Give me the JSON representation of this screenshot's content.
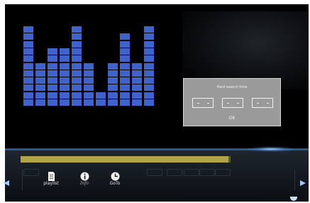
{
  "equalizer": {
    "color": "#3f63cc",
    "bars": [
      11,
      6,
      8,
      8,
      11,
      6,
      2,
      6,
      10,
      6,
      11
    ]
  },
  "dialog": {
    "title": "Hard search time",
    "time_fields": [
      "- -  :  - -",
      "- -  :  - -",
      "- -  :  - -"
    ],
    "ok_label": "OK"
  },
  "progress": {
    "fraction": 0.99,
    "color": "#b2a24a"
  },
  "menu": {
    "items": [
      {
        "name": "playlist",
        "label": "playlist",
        "icon": "document-icon"
      },
      {
        "name": "info",
        "label": "Info",
        "icon": "info-icon"
      },
      {
        "name": "goto",
        "label": "GoTo",
        "icon": "clock-icon"
      }
    ]
  }
}
